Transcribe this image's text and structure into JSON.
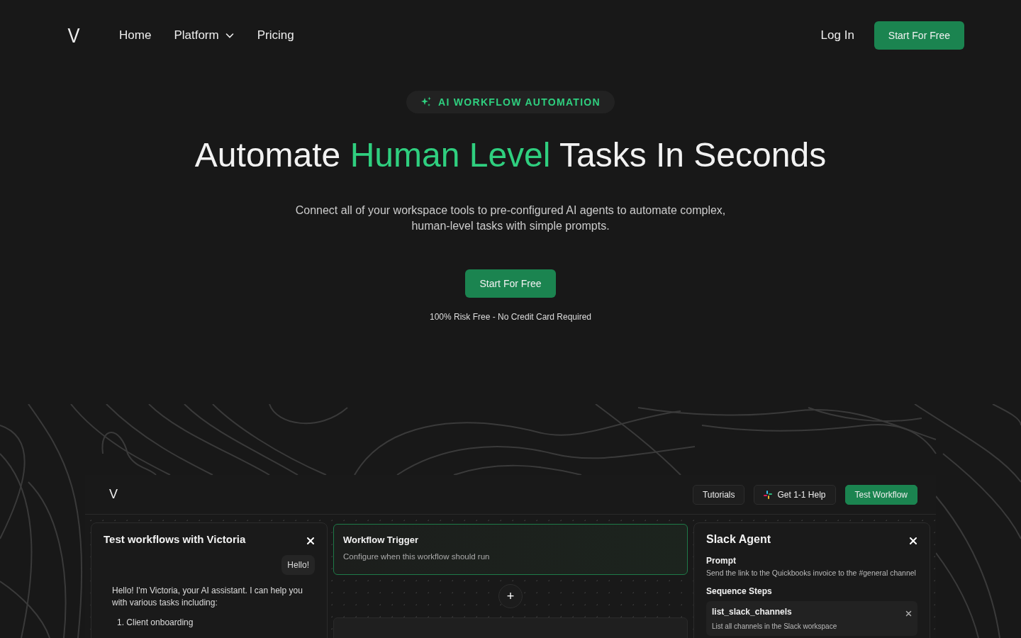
{
  "header": {
    "logo": "V",
    "nav": [
      {
        "label": "Home",
        "dropdown": false
      },
      {
        "label": "Platform",
        "dropdown": true
      },
      {
        "label": "Pricing",
        "dropdown": false
      }
    ],
    "login": "Log In",
    "cta": "Start For Free"
  },
  "hero": {
    "badge": "AI WORKFLOW AUTOMATION",
    "title": [
      {
        "text": "Automate ",
        "highlight": false
      },
      {
        "text": "Human Level",
        "highlight": true
      },
      {
        "text": " Tasks In Seconds",
        "highlight": false
      }
    ],
    "subtitle": "Connect all of your workspace tools to pre-configured AI agents to automate complex, human-level tasks with simple prompts.",
    "cta": "Start For Free",
    "note": "100% Risk Free - No Credit Card Required"
  },
  "app": {
    "logo": "V",
    "buttons": [
      {
        "label": "Tutorials",
        "kind": "plain"
      },
      {
        "label": "Get 1-1 Help",
        "kind": "slack"
      },
      {
        "label": "Test Workflow",
        "kind": "primary"
      }
    ],
    "chat": {
      "title": "Test workflows with Victoria",
      "user_message": "Hello!",
      "assistant_message": "Hello! I'm Victoria, your AI assistant. I can help you with various tasks including:",
      "list": [
        "1. Client onboarding"
      ]
    },
    "canvas": {
      "nodes": [
        {
          "title": "Workflow Trigger",
          "description": "Configure when this workflow should run",
          "selected": true
        },
        {
          "selected": false
        }
      ],
      "add_button": "+"
    },
    "agent": {
      "title": "Slack Agent",
      "prompt_label": "Prompt",
      "prompt": "Send the link to the Quickbooks invoice to the #general channel",
      "steps_label": "Sequence Steps",
      "steps": [
        {
          "name": "list_slack_channels",
          "description": "List all channels in the Slack workspace"
        }
      ]
    }
  }
}
